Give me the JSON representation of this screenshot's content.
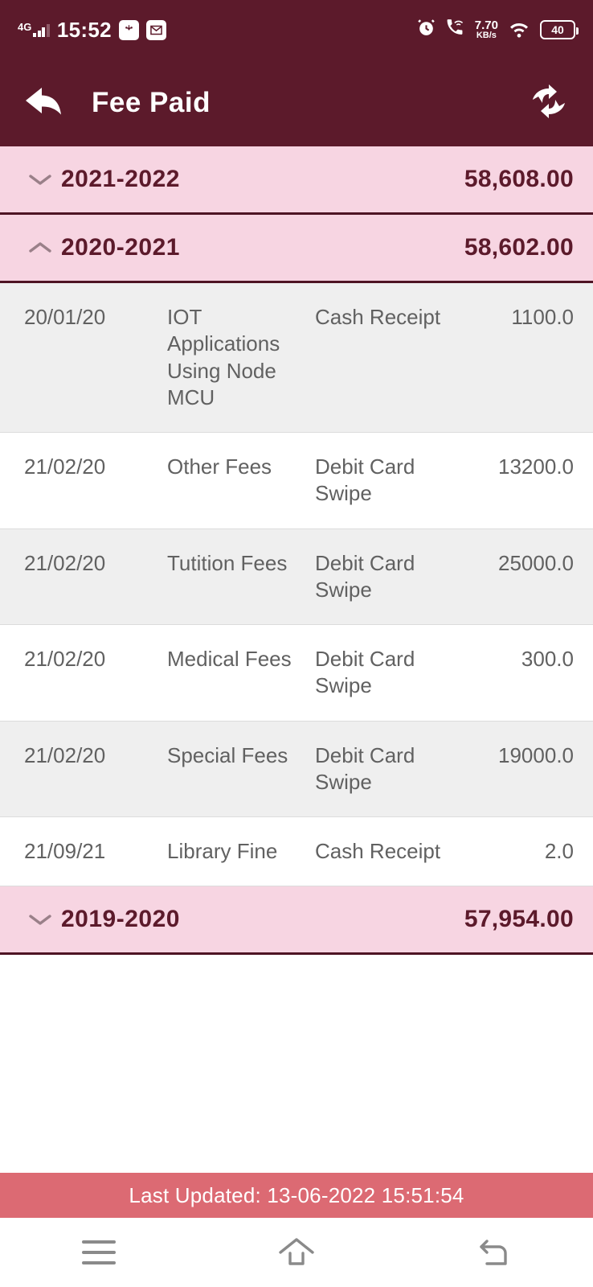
{
  "statusbar": {
    "network_type": "4G",
    "time": "15:52",
    "badge_icons": [
      "usb-debug-icon",
      "mail-icon"
    ],
    "alarm_icon": "alarm-clock-icon",
    "call_icon": "vowifi-call-icon",
    "data_rate_value": "7.70",
    "data_rate_unit": "KB/s",
    "wifi_icon": "wifi-icon",
    "battery_level": "40"
  },
  "appbar": {
    "back_icon": "back-arrow-icon",
    "title": "Fee Paid",
    "sync_icon": "sync-icon"
  },
  "colors": {
    "header_maroon": "#5C1A2B",
    "band_pink": "#F7D5E2",
    "divider_maroon": "#4E1424",
    "row_alt_gray": "#EFEFEF",
    "row_white": "#FFFFFF",
    "footer_coral": "#DC6A73",
    "body_text_gray": "#616161"
  },
  "years": [
    {
      "label": "2021-2022",
      "amount": "58,608.00",
      "expanded": false,
      "chevron": "chevron-down-icon"
    },
    {
      "label": "2020-2021",
      "amount": "58,602.00",
      "expanded": true,
      "chevron": "chevron-up-icon"
    },
    {
      "label": "2019-2020",
      "amount": "57,954.00",
      "expanded": false,
      "chevron": "chevron-down-icon"
    }
  ],
  "transactions": [
    {
      "date": "20/01/20",
      "head": "IOT Applications Using Node MCU",
      "mode": "Cash Receipt",
      "amount": "1100.0"
    },
    {
      "date": "21/02/20",
      "head": "Other Fees",
      "mode": "Debit Card Swipe",
      "amount": "13200.0"
    },
    {
      "date": "21/02/20",
      "head": "Tutition Fees",
      "mode": "Debit Card Swipe",
      "amount": "25000.0"
    },
    {
      "date": "21/02/20",
      "head": "Medical Fees",
      "mode": "Debit Card Swipe",
      "amount": "300.0"
    },
    {
      "date": "21/02/20",
      "head": "Special Fees",
      "mode": "Debit Card Swipe",
      "amount": "19000.0"
    },
    {
      "date": "21/09/21",
      "head": "Library Fine",
      "mode": "Cash Receipt",
      "amount": "2.0"
    }
  ],
  "footer": {
    "last_updated": "Last Updated: 13-06-2022 15:51:54"
  },
  "navbar": {
    "menu_icon": "menu-icon",
    "home_icon": "home-icon",
    "back_icon": "back-icon"
  }
}
